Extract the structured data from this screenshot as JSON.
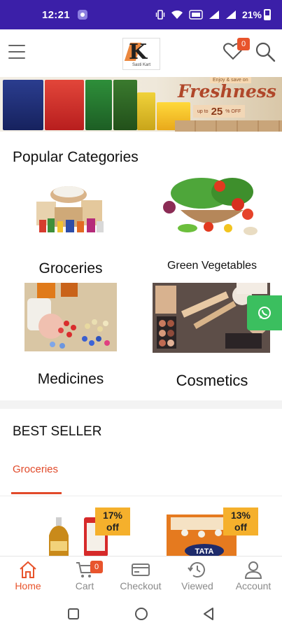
{
  "status_bar": {
    "time": "12:21",
    "battery": "21%"
  },
  "header": {
    "logo_text": "Sasti Kart",
    "wishlist_count": "0"
  },
  "banner": {
    "promo_top": "Enjoy & save on",
    "title": "Freshness",
    "sub_prefix": "up to",
    "discount": "25",
    "sub_suffix": "% OFF"
  },
  "categories": {
    "heading": "Popular Categories",
    "items": [
      {
        "label": "Groceries"
      },
      {
        "label": "Green Vegetables"
      },
      {
        "label": "Medicines"
      },
      {
        "label": "Cosmetics"
      }
    ]
  },
  "best_seller": {
    "heading": "BEST SELLER",
    "active_tab": "Groceries",
    "products": [
      {
        "discount_line1": "17%",
        "discount_line2": "off"
      },
      {
        "discount_line1": "13%",
        "discount_line2": "off"
      }
    ]
  },
  "bottom_nav": {
    "cart_count": "0",
    "items": [
      {
        "label": "Home"
      },
      {
        "label": "Cart"
      },
      {
        "label": "Checkout"
      },
      {
        "label": "Viewed"
      },
      {
        "label": "Account"
      }
    ]
  },
  "colors": {
    "status_bar": "#3b1fa8",
    "accent": "#e8542c",
    "whatsapp": "#3bbf5f",
    "discount_tag": "#f5b02c"
  }
}
